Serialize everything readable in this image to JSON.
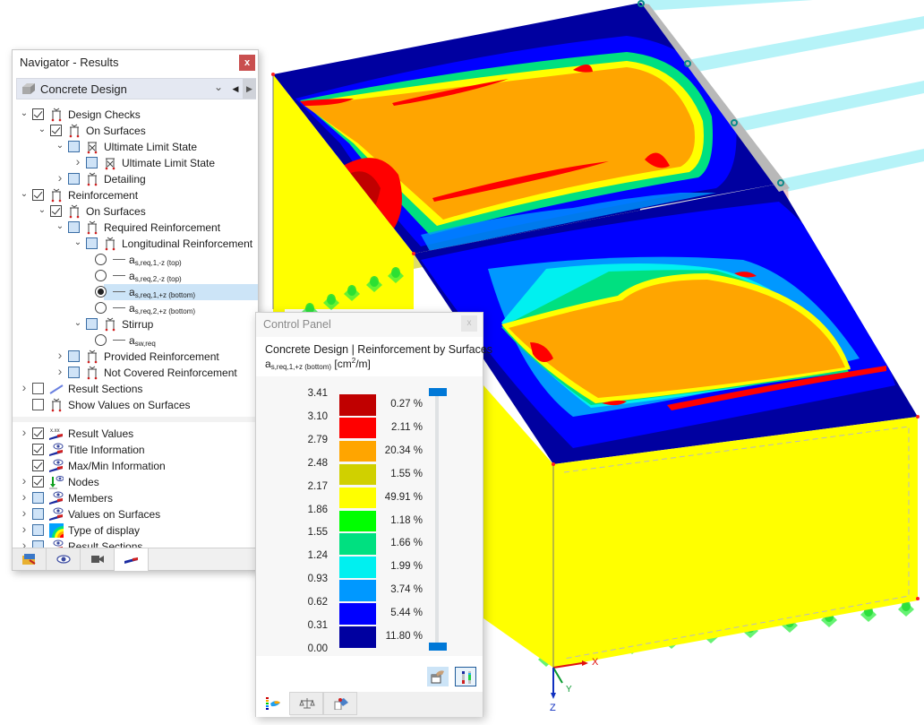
{
  "navigator": {
    "title": "Navigator - Results",
    "close_label": "x",
    "module": "Concrete Design",
    "tree": [
      {
        "label": "Design Checks",
        "state": "checked",
        "expanded": true
      },
      {
        "label": "On Surfaces",
        "state": "checked",
        "expanded": true
      },
      {
        "label": "Ultimate Limit State",
        "state": "partial",
        "expanded": true
      },
      {
        "label": "Ultimate Limit State",
        "state": "partial",
        "expanded": false
      },
      {
        "label": "Detailing",
        "state": "partial",
        "expanded": false
      },
      {
        "label": "Reinforcement",
        "state": "checked",
        "expanded": true
      },
      {
        "label": "On Surfaces",
        "state": "checked",
        "expanded": true
      },
      {
        "label": "Required Reinforcement",
        "state": "partial",
        "expanded": true
      },
      {
        "label": "Longitudinal Reinforcement",
        "state": "partial",
        "expanded": true
      },
      {
        "label": "a",
        "sub": "s,req,1,-z (top)",
        "type": "radio",
        "selected": false
      },
      {
        "label": "a",
        "sub": "s,req,2,-z (top)",
        "type": "radio",
        "selected": false
      },
      {
        "label": "a",
        "sub": "s,req,1,+z (bottom)",
        "type": "radio",
        "selected": true
      },
      {
        "label": "a",
        "sub": "s,req,2,+z (bottom)",
        "type": "radio",
        "selected": false
      },
      {
        "label": "Stirrup",
        "state": "partial",
        "expanded": true
      },
      {
        "label": "a",
        "sub": "sw,req",
        "type": "radio",
        "selected": false
      },
      {
        "label": "Provided Reinforcement",
        "state": "partial",
        "expanded": false
      },
      {
        "label": "Not Covered Reinforcement",
        "state": "partial",
        "expanded": false
      },
      {
        "label": "Result Sections",
        "state": "empty",
        "expanded": false
      },
      {
        "label": "Show Values on Surfaces",
        "state": "empty"
      }
    ],
    "display_items": [
      {
        "label": "Result Values",
        "state": "checked",
        "icon": "result-values-icon"
      },
      {
        "label": "Title Information",
        "state": "checked",
        "icon": "eye-info-icon"
      },
      {
        "label": "Max/Min Information",
        "state": "checked",
        "icon": "eye-info-icon"
      },
      {
        "label": "Nodes",
        "state": "checked",
        "icon": "nodes-icon"
      },
      {
        "label": "Members",
        "state": "partial",
        "icon": "eye-info-icon"
      },
      {
        "label": "Values on Surfaces",
        "state": "partial",
        "icon": "eye-info-icon"
      },
      {
        "label": "Type of display",
        "state": "partial",
        "icon": "contour-icon"
      },
      {
        "label": "Result Sections",
        "state": "partial",
        "icon": "eye-info-icon"
      }
    ],
    "tabs": [
      "data-tab",
      "view-tab",
      "camera-tab",
      "results-tab"
    ]
  },
  "control_panel": {
    "title": "Control Panel",
    "close_label": "x",
    "heading": "Concrete Design | Reinforcement by Surfaces",
    "quantity": "a",
    "quantity_sub": "s,req,1,+z (bottom)",
    "unit_prefix": "[cm",
    "unit_sup": "2",
    "unit_suffix": "/m]",
    "legend": {
      "values": [
        "3.41",
        "3.10",
        "2.79",
        "2.48",
        "2.17",
        "1.86",
        "1.55",
        "1.24",
        "0.93",
        "0.62",
        "0.31",
        "0.00"
      ],
      "bands": [
        {
          "color": "#c00000",
          "percent": "0.27 %"
        },
        {
          "color": "#ff0000",
          "percent": "2.11 %"
        },
        {
          "color": "#ffa500",
          "percent": "20.34 %"
        },
        {
          "color": "#d0d000",
          "percent": "1.55 %"
        },
        {
          "color": "#ffff00",
          "percent": "49.91 %"
        },
        {
          "color": "#00ff00",
          "percent": "1.18 %"
        },
        {
          "color": "#00e080",
          "percent": "1.66 %"
        },
        {
          "color": "#00f0f0",
          "percent": "1.99 %"
        },
        {
          "color": "#0098ff",
          "percent": "3.74 %"
        },
        {
          "color": "#0000ff",
          "percent": "5.44 %"
        },
        {
          "color": "#0000a0",
          "percent": "11.80 %"
        }
      ],
      "slider_range": [
        0.0,
        1.0
      ]
    },
    "tabs": [
      "color-scale-tab",
      "factors-tab",
      "export-tab"
    ]
  },
  "viewport": {
    "axes": {
      "x": "X",
      "y": "Y",
      "z": "Z"
    }
  }
}
